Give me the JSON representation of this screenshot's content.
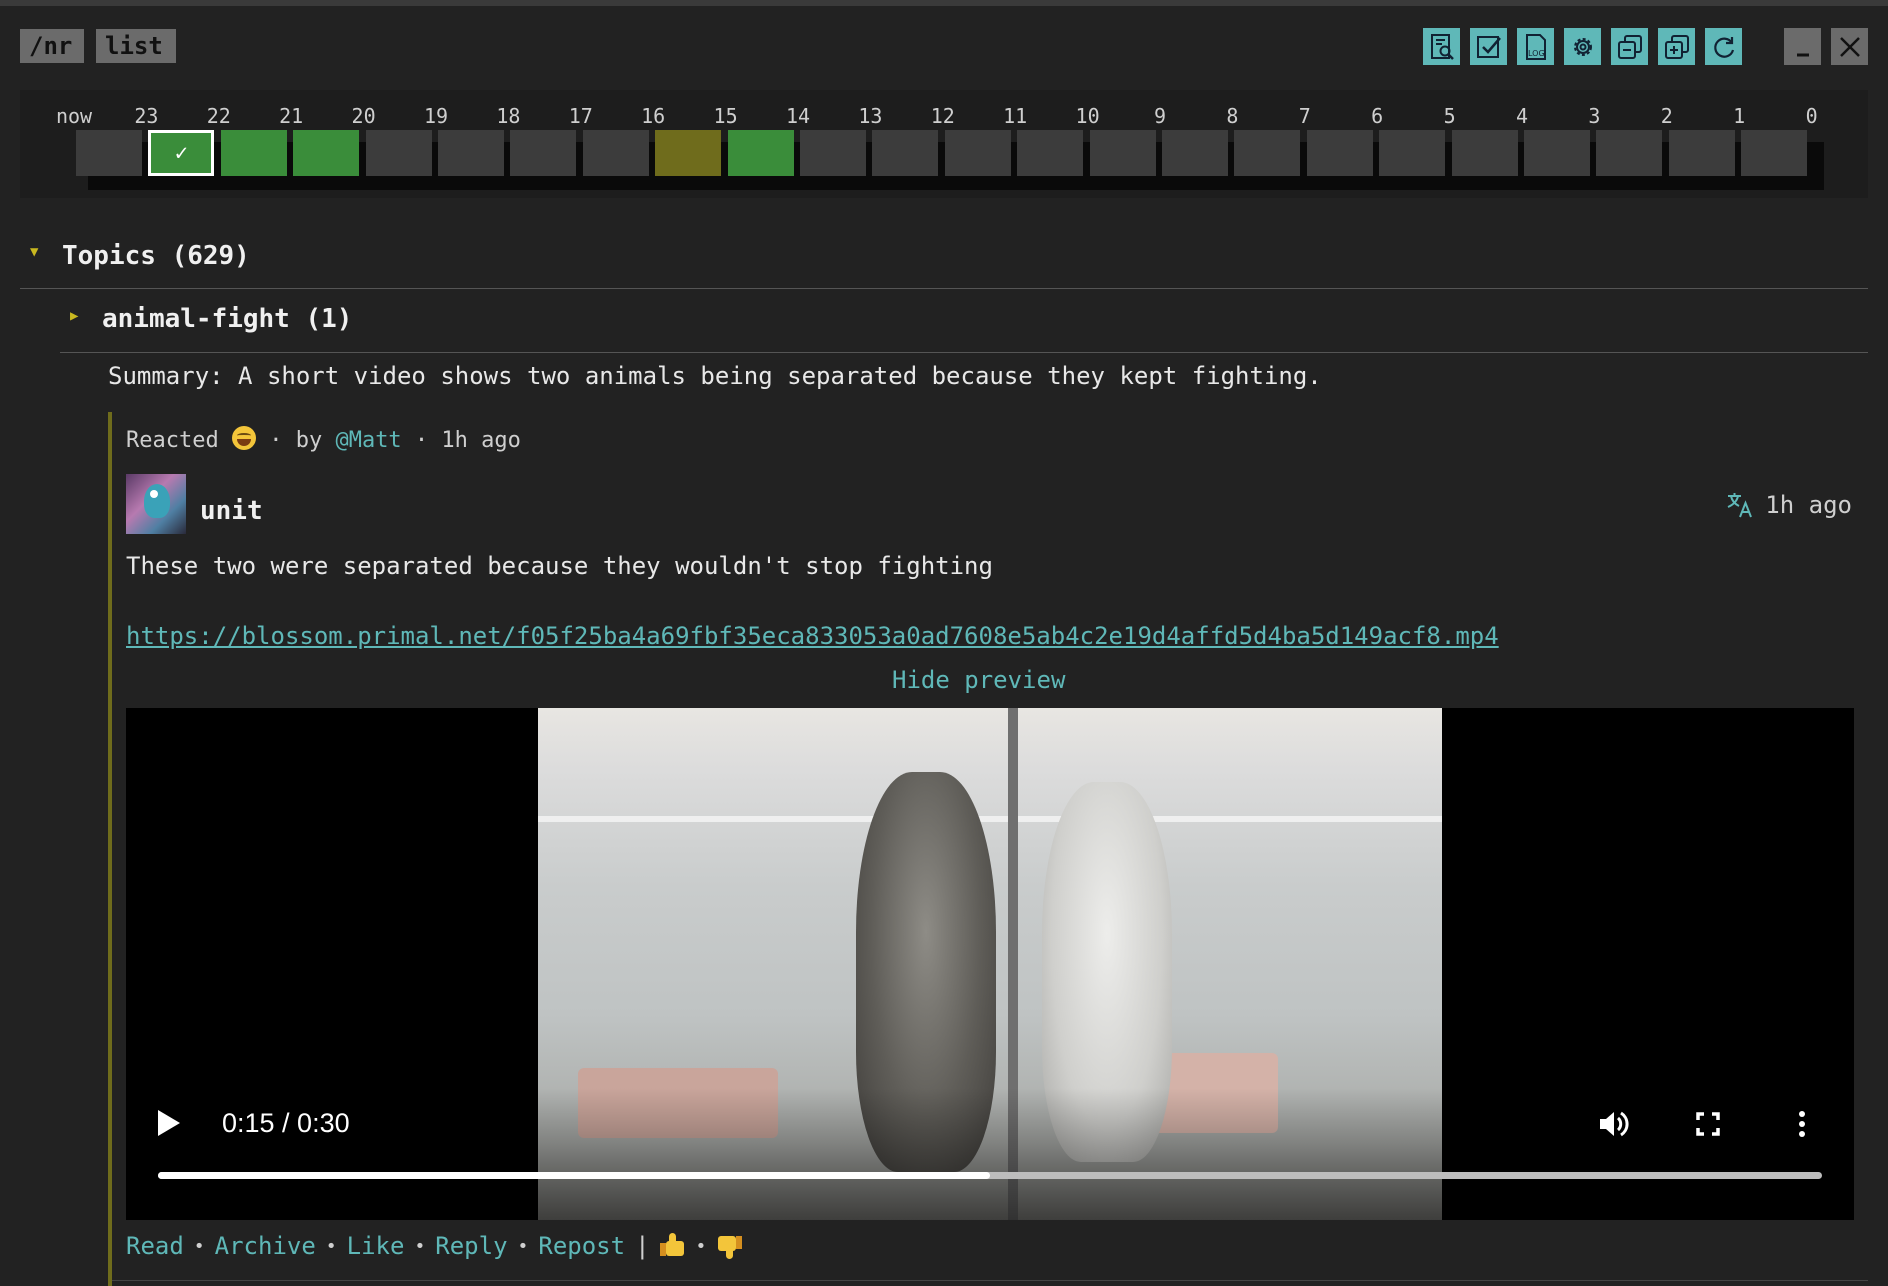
{
  "tags": {
    "nr": "/nr",
    "list": "list"
  },
  "toolbar": {
    "icons": [
      "search-document-icon",
      "checkbox-icon",
      "log-icon",
      "settings-gear-icon",
      "restore-window-icon",
      "add-window-icon",
      "refresh-icon"
    ],
    "window": [
      "minimize-icon",
      "close-icon"
    ],
    "log_label": "LOG"
  },
  "timeline": {
    "labels": [
      "now",
      "23",
      "22",
      "21",
      "20",
      "19",
      "18",
      "17",
      "16",
      "15",
      "14",
      "13",
      "12",
      "11",
      "10",
      "9",
      "8",
      "7",
      "6",
      "5",
      "4",
      "3",
      "2",
      "1",
      "0"
    ],
    "cells": [
      "grey",
      "selected",
      "green",
      "green",
      "grey",
      "grey",
      "grey",
      "grey",
      "olive",
      "green",
      "grey",
      "grey",
      "grey",
      "grey",
      "grey",
      "grey",
      "grey",
      "grey",
      "grey",
      "grey",
      "grey",
      "grey",
      "grey",
      "grey"
    ],
    "check": "✓",
    "colors": {
      "grey": "#3c3c3c",
      "green": "#3a8d3a",
      "olive": "#6f6c1c"
    }
  },
  "topics": {
    "title": "Topics (629)",
    "expanded_marker": "▼",
    "group": {
      "title": "animal-fight (1)",
      "collapsed_marker": "▶",
      "summary": "Summary: A short video shows two animals being separated because they kept fighting."
    }
  },
  "post": {
    "reacted_prefix": "Reacted",
    "reacted_emoji": "laughing-emoji",
    "reacted_by": " · by ",
    "mention": "@Matt",
    "reacted_time": " · 1h ago",
    "author": "unit",
    "time": "1h ago",
    "translate_icon": "translate-icon",
    "content": "These two were separated because they wouldn't stop fighting",
    "link": "https://blossom.primal.net/f05f25ba4a69fbf35eca833053a0ad7608e5ab4c2e19d4affd5d4ba5d149acf8.mp4",
    "hide_preview": "Hide preview",
    "video": {
      "time": "0:15 / 0:30",
      "progress": 0.5
    }
  },
  "actions": {
    "read": "Read",
    "archive": "Archive",
    "like": "Like",
    "reply": "Reply",
    "repost": "Repost",
    "sep": "•",
    "pipe": "|"
  },
  "colors": {
    "accent": "#5fb8b8",
    "olive": "#c9b820",
    "background": "#222222"
  }
}
